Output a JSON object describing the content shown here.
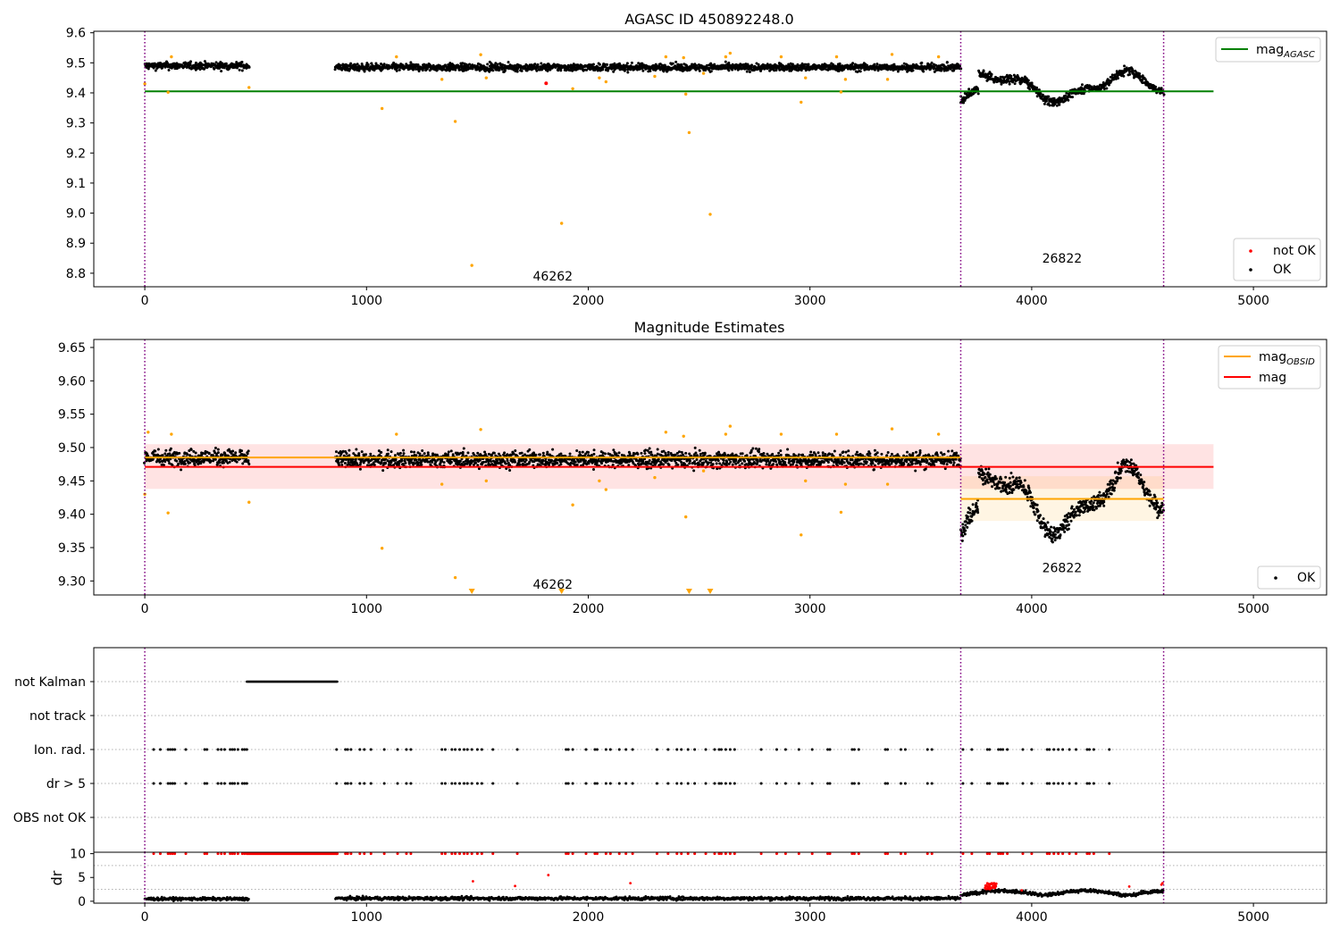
{
  "colors": {
    "ok": "#000000",
    "not_ok": "#ff0000",
    "outlier": "#ffa500",
    "agasc_line": "#008000",
    "mag_line": "#ff0000",
    "mag_obsid_line": "#ffa500",
    "boundary": "#800080",
    "flag_grid": "#b0b0b0"
  },
  "chart_data": [
    {
      "type": "scatter",
      "title": "AGASC ID 450892248.0",
      "xlabel": "",
      "ylabel": "",
      "xlim": [
        -230,
        5330
      ],
      "ylim": [
        8.755,
        9.605
      ],
      "xticks": [
        "0",
        "1000",
        "2000",
        "3000",
        "4000",
        "5000"
      ],
      "yticks": [
        "8.8",
        "8.9",
        "9.0",
        "9.1",
        "9.2",
        "9.3",
        "9.4",
        "9.5",
        "9.6"
      ],
      "legend_upper": {
        "placement": "top-right",
        "entries": [
          {
            "label": "mag",
            "sub": "AGASC",
            "marker": "line",
            "color": "#008000"
          }
        ]
      },
      "legend_lower": {
        "placement": "bottom-right",
        "entries": [
          {
            "label": "not OK",
            "marker": "dot",
            "color": "#ff0000"
          },
          {
            "label": "OK",
            "marker": "dot",
            "color": "#000000"
          }
        ]
      },
      "hlines": [
        {
          "name": "mag_AGASC",
          "y": 9.405,
          "x": [
            0,
            4820
          ],
          "color": "#008000"
        }
      ],
      "vlines": [
        0,
        3680,
        4595
      ],
      "annotations": [
        {
          "text": "46262",
          "x": 1840,
          "y": 8.79
        },
        {
          "text": "26822",
          "x": 4137,
          "y": 8.85
        }
      ],
      "series": [
        {
          "name": "OK",
          "segments": [
            {
              "x": [
                0,
                470
              ],
              "level": 9.49,
              "noise": 0.012
            },
            {
              "x": [
                860,
                3680
              ],
              "level": 9.485,
              "noise": 0.012
            },
            {
              "x": [
                3680,
                4595
              ],
              "level": 9.42,
              "noise": 0.03,
              "drift": true
            }
          ]
        },
        {
          "name": "not OK",
          "points": [
            [
              1810,
              9.432
            ]
          ]
        },
        {
          "name": "outliers",
          "points": [
            [
              0,
              9.43
            ],
            [
              105,
              9.402
            ],
            [
              120,
              9.52
            ],
            [
              470,
              9.418
            ],
            [
              1070,
              9.348
            ],
            [
              1135,
              9.52
            ],
            [
              1340,
              9.445
            ],
            [
              1400,
              9.305
            ],
            [
              1475,
              8.826
            ],
            [
              1515,
              9.527
            ],
            [
              1540,
              9.45
            ],
            [
              1880,
              8.966
            ],
            [
              1930,
              9.414
            ],
            [
              2050,
              9.45
            ],
            [
              2080,
              9.437
            ],
            [
              2300,
              9.455
            ],
            [
              2350,
              9.52
            ],
            [
              2430,
              9.517
            ],
            [
              2440,
              9.396
            ],
            [
              2455,
              9.268
            ],
            [
              2520,
              9.465
            ],
            [
              2550,
              8.996
            ],
            [
              2620,
              9.52
            ],
            [
              2640,
              9.532
            ],
            [
              2870,
              9.52
            ],
            [
              2960,
              9.369
            ],
            [
              2980,
              9.45
            ],
            [
              3120,
              9.52
            ],
            [
              3140,
              9.403
            ],
            [
              3160,
              9.445
            ],
            [
              3350,
              9.445
            ],
            [
              3370,
              9.528
            ],
            [
              3580,
              9.52
            ]
          ]
        }
      ]
    },
    {
      "type": "scatter",
      "title": "Magnitude Estimates",
      "xlabel": "",
      "ylabel": "",
      "xlim": [
        -230,
        5330
      ],
      "ylim": [
        9.279,
        9.662
      ],
      "xticks": [
        "0",
        "1000",
        "2000",
        "3000",
        "4000",
        "5000"
      ],
      "yticks": [
        "9.30",
        "9.35",
        "9.40",
        "9.45",
        "9.50",
        "9.55",
        "9.60",
        "9.65"
      ],
      "legend_upper": {
        "placement": "top-right",
        "entries": [
          {
            "label": "mag",
            "sub": "OBSID",
            "marker": "line",
            "color": "#ffa500"
          },
          {
            "label": "mag",
            "marker": "line",
            "color": "#ff0000"
          }
        ]
      },
      "legend_lower": {
        "placement": "bottom-right",
        "entries": [
          {
            "label": "OK",
            "marker": "dot",
            "color": "#000000"
          }
        ]
      },
      "bands": [
        {
          "name": "mag",
          "x": [
            0,
            4820
          ],
          "y": [
            9.438,
            9.505
          ],
          "color": "#ff0000",
          "opacity": 0.11
        },
        {
          "name": "mag_OBSID 26822",
          "x": [
            3680,
            4595
          ],
          "y": [
            9.39,
            9.457
          ],
          "color": "#ffa500",
          "opacity": 0.11
        }
      ],
      "hlines": [
        {
          "name": "mag",
          "y": 9.471,
          "x": [
            0,
            4820
          ],
          "color": "#ff0000"
        },
        {
          "name": "mag_OBSID 46262",
          "y": 9.485,
          "x": [
            0,
            3680
          ],
          "color": "#ffa500"
        },
        {
          "name": "mag_OBSID 26822",
          "y": 9.423,
          "x": [
            3680,
            4595
          ],
          "color": "#ffa500"
        }
      ],
      "vlines": [
        0,
        3680,
        4595
      ],
      "annotations": [
        {
          "text": "46262",
          "x": 1840,
          "y": 9.295
        },
        {
          "text": "26822",
          "x": 4137,
          "y": 9.32
        }
      ],
      "series": [
        {
          "name": "OK",
          "segments": [
            {
              "x": [
                0,
                470
              ],
              "level": 9.485,
              "noise": 0.012
            },
            {
              "x": [
                860,
                3680
              ],
              "level": 9.482,
              "noise": 0.012
            },
            {
              "x": [
                3680,
                4595
              ],
              "level": 9.42,
              "noise": 0.03,
              "drift": true
            }
          ]
        },
        {
          "name": "outliers",
          "points": [
            [
              15,
              9.523
            ],
            [
              0,
              9.43
            ],
            [
              105,
              9.402
            ],
            [
              120,
              9.52
            ],
            [
              470,
              9.418
            ],
            [
              1070,
              9.349
            ],
            [
              1135,
              9.52
            ],
            [
              1340,
              9.445
            ],
            [
              1400,
              9.305
            ],
            [
              1515,
              9.527
            ],
            [
              1540,
              9.45
            ],
            [
              1930,
              9.414
            ],
            [
              2050,
              9.45
            ],
            [
              2080,
              9.437
            ],
            [
              2300,
              9.455
            ],
            [
              2350,
              9.523
            ],
            [
              2430,
              9.517
            ],
            [
              2440,
              9.396
            ],
            [
              2520,
              9.465
            ],
            [
              2620,
              9.52
            ],
            [
              2640,
              9.532
            ],
            [
              2870,
              9.52
            ],
            [
              2960,
              9.369
            ],
            [
              2980,
              9.45
            ],
            [
              3120,
              9.52
            ],
            [
              3140,
              9.403
            ],
            [
              3160,
              9.445
            ],
            [
              3350,
              9.445
            ],
            [
              3370,
              9.528
            ],
            [
              3580,
              9.52
            ]
          ]
        },
        {
          "name": "below range",
          "marker": "triangle-down",
          "x": [
            1475,
            1880,
            2455,
            2550
          ]
        }
      ]
    },
    {
      "type": "scatter",
      "title": "",
      "xlabel": "",
      "ylabel": "",
      "xlim": [
        -230,
        5330
      ],
      "categories": [
        "not Kalman",
        "not track",
        "Ion. rad.",
        "dr > 5",
        "OBS not OK"
      ],
      "vlines": [
        0,
        3680,
        4595
      ],
      "series": [
        {
          "name": "not Kalman",
          "ranges": [
            [
              460,
              870
            ]
          ]
        },
        {
          "name": "not track",
          "x": []
        },
        {
          "name": "Ion. rad.",
          "x": [
            40,
            70,
            105,
            115,
            125,
            135,
            185,
            270,
            280,
            330,
            345,
            360,
            385,
            395,
            405,
            420,
            440,
            450,
            460,
            865,
            905,
            915,
            930,
            970,
            990,
            1020,
            1080,
            1140,
            1180,
            1200,
            1340,
            1355,
            1385,
            1400,
            1420,
            1440,
            1455,
            1475,
            1500,
            1520,
            1570,
            1680,
            1900,
            1910,
            1930,
            1990,
            2030,
            2040,
            2080,
            2100,
            2140,
            2170,
            2200,
            2310,
            2360,
            2400,
            2420,
            2450,
            2480,
            2530,
            2570,
            2590,
            2600,
            2620,
            2640,
            2660,
            2780,
            2850,
            2890,
            2950,
            3010,
            3080,
            3090,
            3190,
            3200,
            3220,
            3340,
            3350,
            3410,
            3430,
            3530,
            3550,
            3690,
            3730,
            3800,
            3810,
            3850,
            3860,
            3870,
            3890,
            3960,
            4000,
            4070,
            4080,
            4100,
            4120,
            4140,
            4170,
            4200,
            4250,
            4260,
            4280,
            4350
          ]
        },
        {
          "name": "dr > 5",
          "x": [
            40,
            70,
            105,
            115,
            125,
            135,
            185,
            270,
            280,
            330,
            345,
            360,
            385,
            395,
            405,
            420,
            440,
            450,
            460,
            865,
            905,
            915,
            930,
            970,
            990,
            1020,
            1080,
            1140,
            1180,
            1200,
            1340,
            1355,
            1385,
            1400,
            1420,
            1440,
            1455,
            1475,
            1500,
            1520,
            1570,
            1680,
            1900,
            1910,
            1930,
            1990,
            2030,
            2040,
            2080,
            2100,
            2140,
            2170,
            2200,
            2310,
            2360,
            2400,
            2420,
            2450,
            2480,
            2530,
            2570,
            2590,
            2600,
            2620,
            2640,
            2660,
            2780,
            2850,
            2890,
            2950,
            3010,
            3080,
            3090,
            3190,
            3200,
            3220,
            3340,
            3350,
            3410,
            3430,
            3530,
            3550,
            3690,
            3730,
            3800,
            3810,
            3850,
            3860,
            3870,
            3890,
            3960,
            4000,
            4070,
            4080,
            4100,
            4120,
            4140,
            4170,
            4200,
            4250,
            4260,
            4280,
            4350
          ]
        },
        {
          "name": "OBS not OK",
          "x": []
        }
      ]
    },
    {
      "type": "scatter",
      "title": "",
      "xlabel": "",
      "ylabel": "dr",
      "xlim": [
        -230,
        5330
      ],
      "ylim": [
        -0.4,
        10.3
      ],
      "xticks": [
        "0",
        "1000",
        "2000",
        "3000",
        "4000",
        "5000"
      ],
      "yticks": [
        "0",
        "5",
        "10"
      ],
      "vlines": [
        0,
        3680,
        4595
      ],
      "series": [
        {
          "name": "OK",
          "segments": [
            {
              "x": [
                0,
                470
              ],
              "level": 0.5,
              "noise": 0.3
            },
            {
              "x": [
                860,
                3680
              ],
              "level": 0.6,
              "noise": 0.35
            },
            {
              "x": [
                3680,
                4595
              ],
              "level": 1.2,
              "noise": 0.6,
              "drift": true
            }
          ]
        },
        {
          "name": "not OK (capped)",
          "y": 10,
          "x": [
            40,
            70,
            105,
            115,
            125,
            135,
            185,
            270,
            280,
            330,
            345,
            360,
            385,
            395,
            405,
            420,
            440,
            450,
            865,
            905,
            915,
            930,
            970,
            990,
            1020,
            1080,
            1140,
            1180,
            1200,
            1340,
            1355,
            1385,
            1400,
            1420,
            1440,
            1455,
            1475,
            1500,
            1520,
            1570,
            1680,
            1900,
            1910,
            1930,
            1990,
            2030,
            2040,
            2080,
            2100,
            2140,
            2170,
            2200,
            2310,
            2360,
            2400,
            2420,
            2450,
            2480,
            2530,
            2570,
            2590,
            2600,
            2620,
            2640,
            2660,
            2780,
            2850,
            2890,
            2950,
            3010,
            3080,
            3090,
            3190,
            3200,
            3220,
            3340,
            3350,
            3410,
            3430,
            3530,
            3550,
            3690,
            3730,
            3800,
            3810,
            3850,
            3860,
            3870,
            3890,
            3960,
            4000,
            4070,
            4080,
            4100,
            4120,
            4140,
            4170,
            4200,
            4250,
            4260,
            4280,
            4350
          ],
          "range": [
            460,
            870
          ]
        },
        {
          "name": "not OK",
          "points": [
            [
              1480,
              4.2
            ],
            [
              1670,
              3.2
            ],
            [
              1820,
              5.5
            ],
            [
              2190,
              3.8
            ],
            [
              3955,
              2.3
            ],
            [
              4440,
              3.1
            ],
            [
              4585,
              3.5
            ],
            [
              4590,
              3.8
            ]
          ],
          "cluster": {
            "x": [
              3790,
              3840
            ],
            "y": [
              2.5,
              3.8
            ]
          }
        }
      ]
    }
  ]
}
